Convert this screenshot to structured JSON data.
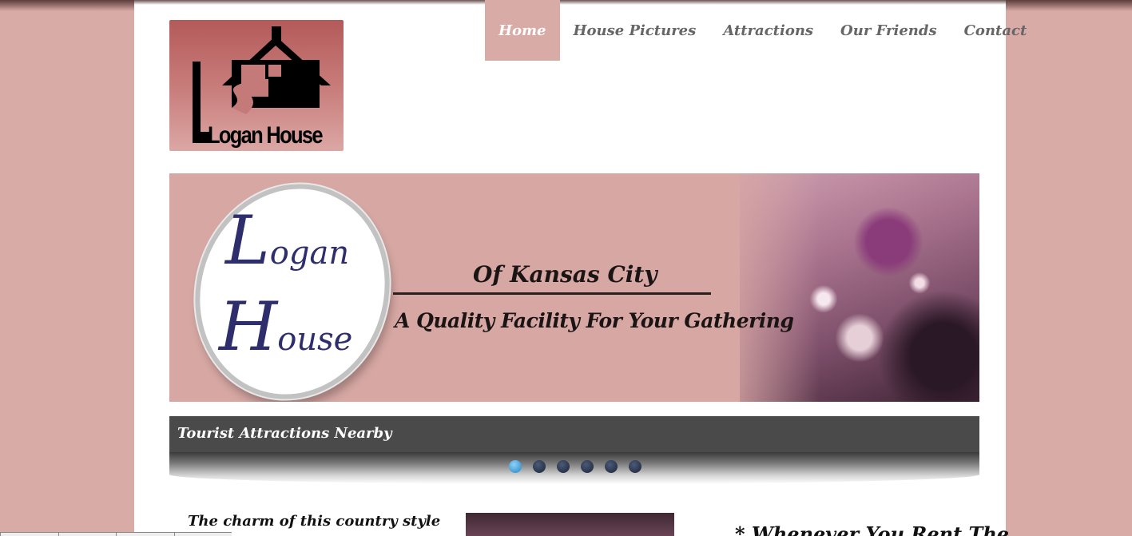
{
  "logo": {
    "text": "Logan House",
    "icon": "house-icon"
  },
  "nav": {
    "items": [
      {
        "label": "Home",
        "active": true
      },
      {
        "label": "House Pictures",
        "active": false
      },
      {
        "label": "Attractions",
        "active": false
      },
      {
        "label": "Our Friends",
        "active": false
      },
      {
        "label": "Contact",
        "active": false
      }
    ]
  },
  "banner": {
    "logo_word_1_initial": "L",
    "logo_word_1_rest": "ogan",
    "logo_word_2_initial": "H",
    "logo_word_2_rest": "ouse",
    "city": "Of Kansas City",
    "tagline": "A Quality Facility For Your Gathering"
  },
  "slider": {
    "caption": "Tourist Attractions Nearby",
    "slide_count": 6,
    "active_slide": 1
  },
  "content": {
    "intro_text": "The charm of this country style",
    "side_heading": "* Whenever You Rent The"
  },
  "colors": {
    "background": "#d9aba7",
    "nav_active": "#d9aba7",
    "caption_bar": "#4a4a4a",
    "dot_active": "#1f86c9"
  }
}
